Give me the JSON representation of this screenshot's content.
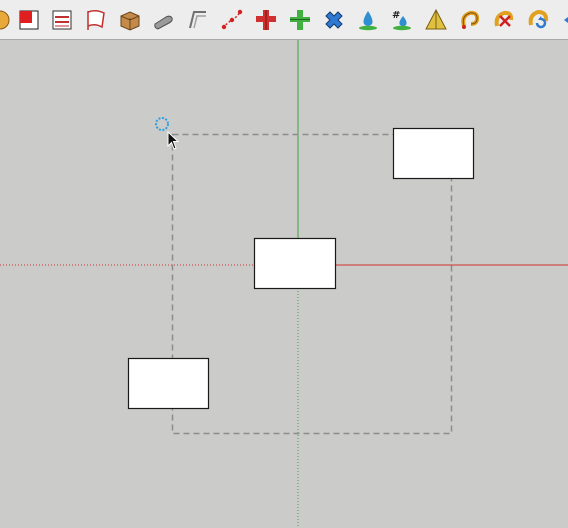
{
  "toolbar": {
    "tools": [
      {
        "name": "orbit-icon",
        "color": "#e8a93a"
      },
      {
        "name": "paint-bucket-icon",
        "color": "#e02020"
      },
      {
        "name": "section-plane-icon",
        "color": "#c03030"
      },
      {
        "name": "flag-icon",
        "color": "#c03030"
      },
      {
        "name": "box-icon",
        "color": "#a8743a"
      },
      {
        "name": "pipe-icon",
        "color": "#8a8a8a"
      },
      {
        "name": "offset-path-icon",
        "color": "#707070"
      },
      {
        "name": "curve-points-icon",
        "color": "#d02020"
      },
      {
        "name": "rail-join-red-icon",
        "color": "#d03030"
      },
      {
        "name": "rail-join-green-icon",
        "color": "#40b040"
      },
      {
        "name": "cross-blue-icon",
        "color": "#2f7ad0"
      },
      {
        "name": "drop-icon",
        "color": "#2f8fd0"
      },
      {
        "name": "hash-drop-icon",
        "color": "#2f8fd0",
        "label": "#"
      },
      {
        "name": "pyramid-icon",
        "color": "#e0c040"
      },
      {
        "name": "arc-arrow-icon",
        "color": "#e0a020"
      },
      {
        "name": "arc-cross-icon",
        "color": "#d02020"
      },
      {
        "name": "arc-refresh-icon",
        "color": "#e0a020"
      },
      {
        "name": "arrow-left-icon",
        "color": "#2f7ad0"
      }
    ]
  },
  "scene": {
    "colors": {
      "background": "#cbcbc9",
      "green_axis": "#3fa23f",
      "red_axis": "#d03030",
      "selection_box": "#8c8c8c",
      "rect_fill": "#ffffff",
      "rect_stroke": "#1a1a1a",
      "cursor_ring": "#2aa0e0"
    }
  }
}
